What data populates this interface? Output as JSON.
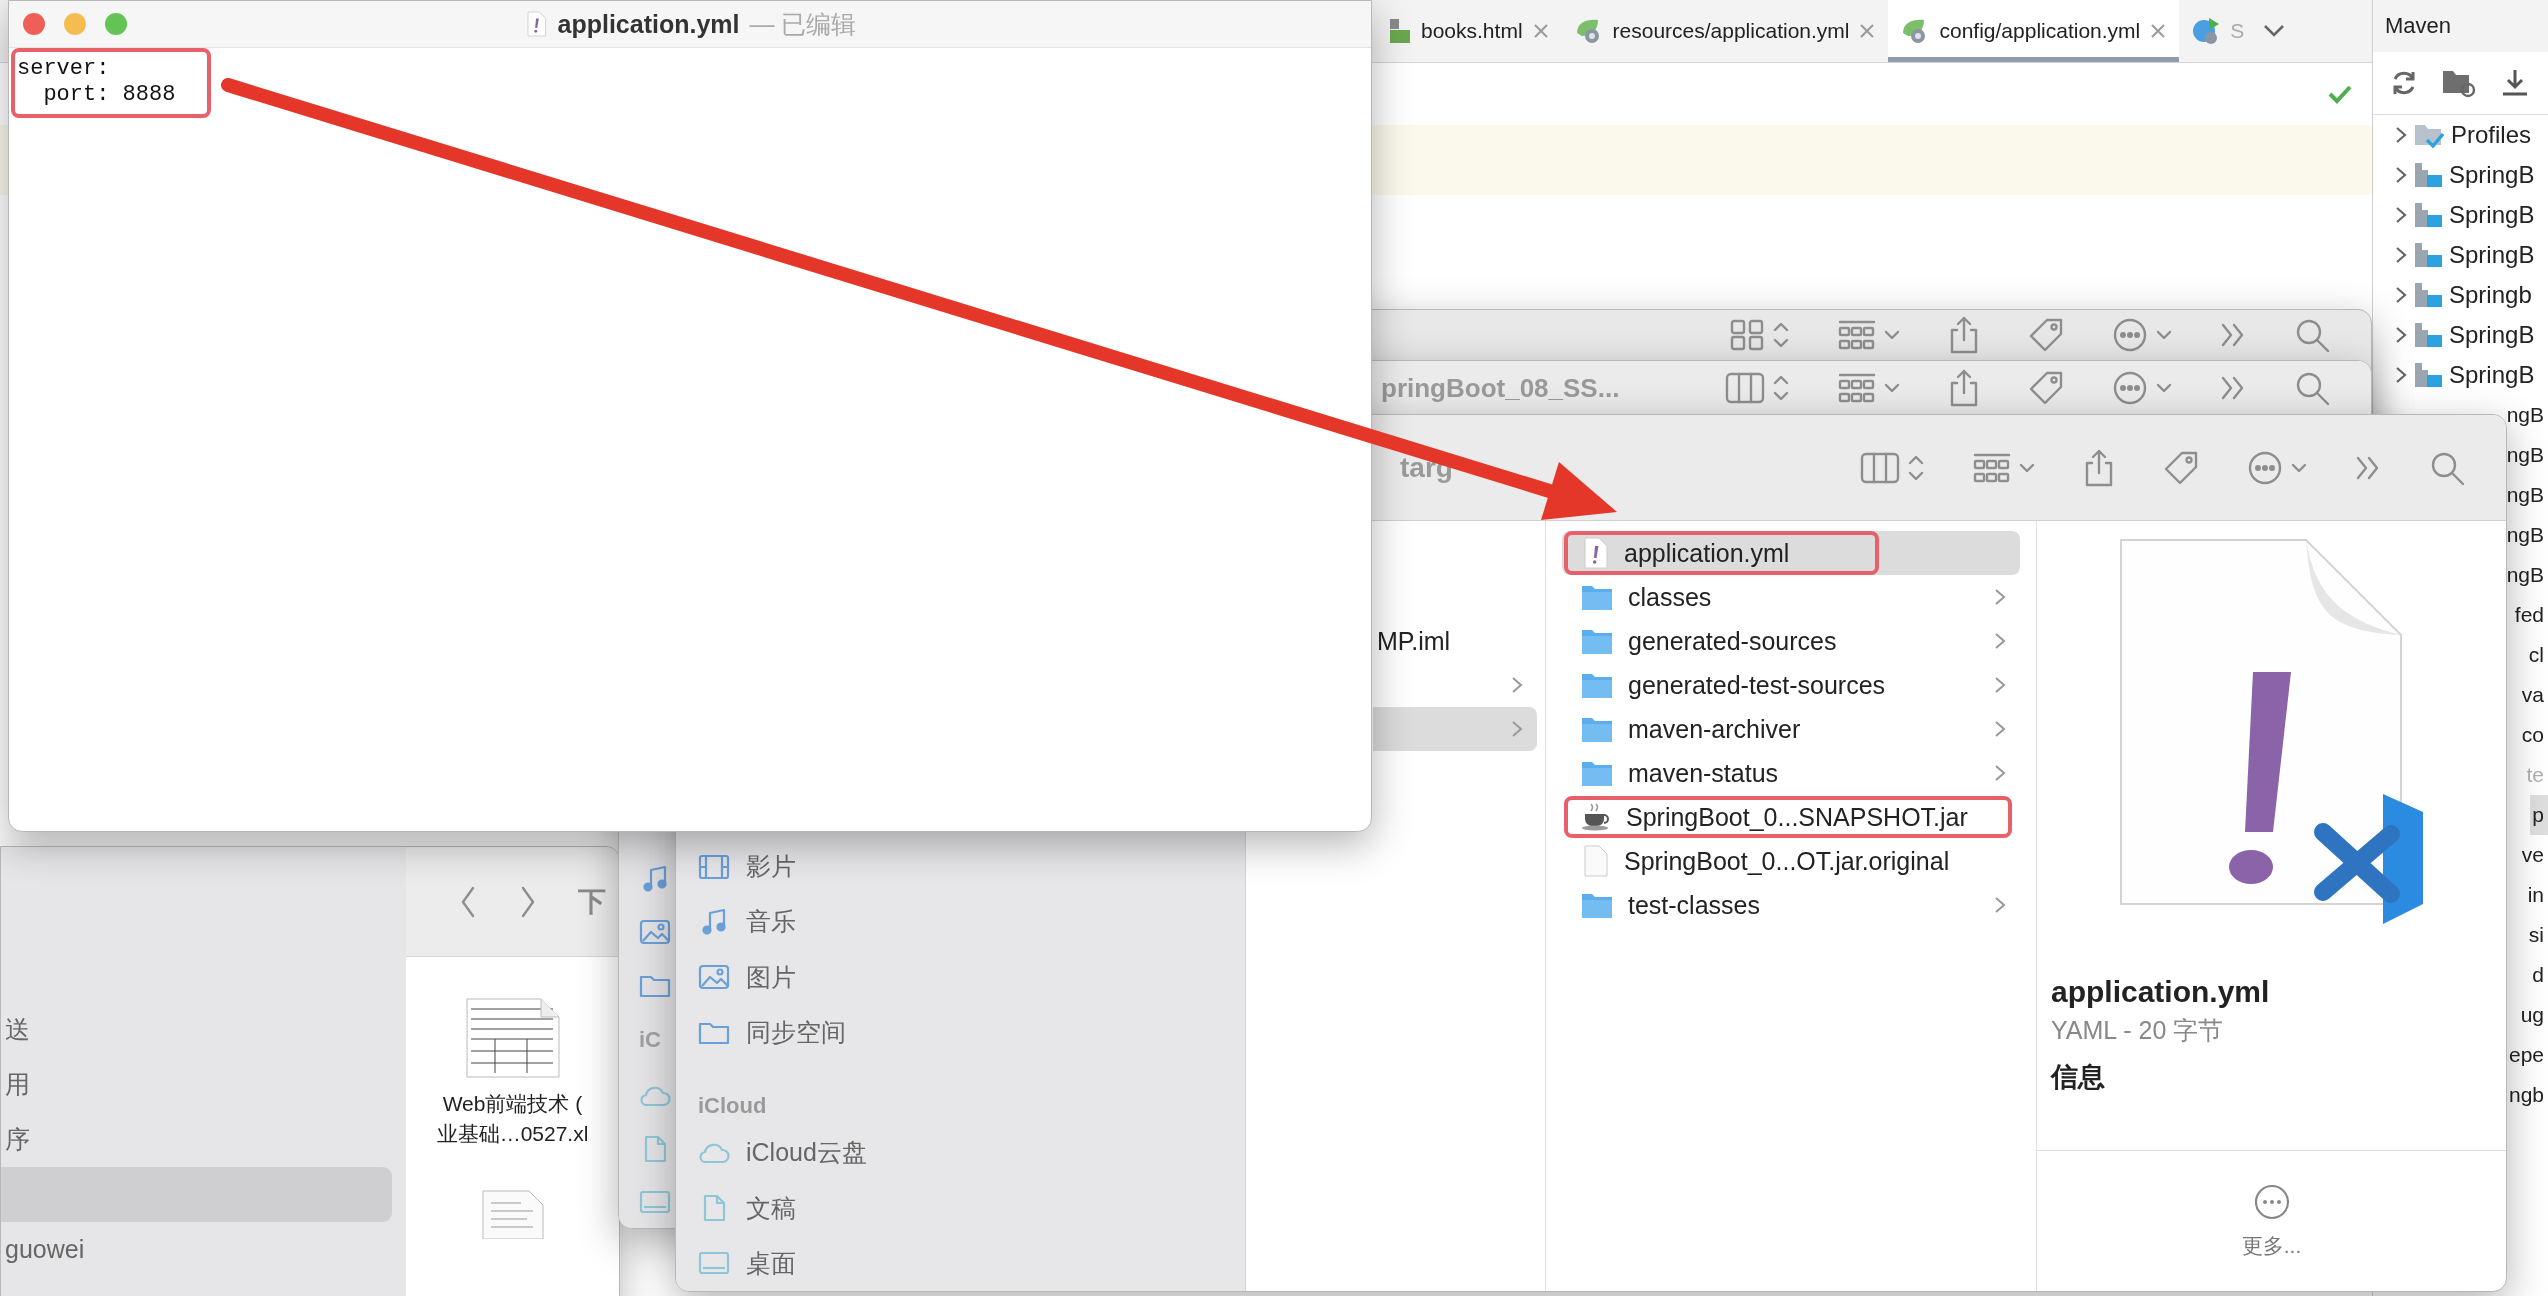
{
  "ide": {
    "tabs": [
      {
        "label": "books.html",
        "kind": "html",
        "selected": false
      },
      {
        "label": "resources/application.yml",
        "kind": "spring",
        "selected": false
      },
      {
        "label": "config/application.yml",
        "kind": "spring",
        "selected": true
      },
      {
        "label": "S",
        "kind": "run",
        "selected": false
      }
    ],
    "maven": {
      "title": "Maven",
      "items": [
        {
          "text": "Profiles",
          "kind": "profiles",
          "selected": false,
          "disabled": false
        },
        {
          "text": "SpringB",
          "kind": "module",
          "selected": false,
          "disabled": false
        },
        {
          "text": "SpringB",
          "kind": "module",
          "selected": false,
          "disabled": false
        },
        {
          "text": "SpringB",
          "kind": "module",
          "selected": false,
          "disabled": false
        },
        {
          "text": "Springb",
          "kind": "module",
          "selected": false,
          "disabled": false
        },
        {
          "text": "SpringB",
          "kind": "module",
          "selected": false,
          "disabled": false
        },
        {
          "text": "SpringB",
          "kind": "module",
          "selected": false,
          "disabled": false
        },
        {
          "text": "ngB",
          "kind": "tail",
          "selected": false,
          "disabled": false
        },
        {
          "text": "ngB",
          "kind": "tail",
          "selected": false,
          "disabled": false
        },
        {
          "text": "ngB",
          "kind": "tail",
          "selected": false,
          "disabled": false
        },
        {
          "text": "ngB",
          "kind": "tail",
          "selected": false,
          "disabled": false
        },
        {
          "text": "ngB",
          "kind": "tail",
          "selected": false,
          "disabled": false
        },
        {
          "text": "fed",
          "kind": "tail",
          "selected": false,
          "disabled": false
        },
        {
          "text": "cl",
          "kind": "tail",
          "selected": false,
          "disabled": false
        },
        {
          "text": "va",
          "kind": "tail",
          "selected": false,
          "disabled": false
        },
        {
          "text": "co",
          "kind": "tail",
          "selected": false,
          "disabled": false
        },
        {
          "text": "te",
          "kind": "tail",
          "selected": false,
          "disabled": true
        },
        {
          "text": "p",
          "kind": "tail",
          "selected": true,
          "disabled": false
        },
        {
          "text": "ve",
          "kind": "tail",
          "selected": false,
          "disabled": false
        },
        {
          "text": "in",
          "kind": "tail",
          "selected": false,
          "disabled": false
        },
        {
          "text": "si",
          "kind": "tail",
          "selected": false,
          "disabled": false
        },
        {
          "text": "d",
          "kind": "tail",
          "selected": false,
          "disabled": false
        },
        {
          "text": "ug",
          "kind": "tail",
          "selected": false,
          "disabled": false
        },
        {
          "text": "epe",
          "kind": "tail",
          "selected": false,
          "disabled": false
        },
        {
          "text": "ngb",
          "kind": "tail",
          "selected": false,
          "disabled": false
        }
      ]
    }
  },
  "editor": {
    "title": "application.yml",
    "status": "— 已编辑",
    "lines": [
      "server:",
      "  port: 8888"
    ],
    "annotated": true
  },
  "finder_middle": {
    "title": "pringBoot_08_SS...",
    "sidebar_section": "iC"
  },
  "finder_front": {
    "title": "targ",
    "sidebar": {
      "items": [
        {
          "label": "影片",
          "kind": "film"
        },
        {
          "label": "音乐",
          "kind": "music"
        },
        {
          "label": "图片",
          "kind": "photo"
        },
        {
          "label": "同步空间",
          "kind": "folder"
        }
      ],
      "section": "iCloud",
      "cloud_items": [
        {
          "label": "iCloud云盘",
          "kind": "cloud"
        },
        {
          "label": "文稿",
          "kind": "doc"
        },
        {
          "label": "桌面",
          "kind": "desktop"
        }
      ]
    },
    "column_1": [
      {
        "label": "MP.iml",
        "kind": "file",
        "selected": false
      },
      {
        "kind": "folder",
        "selected": false
      },
      {
        "kind": "folder",
        "selected": true
      }
    ],
    "files": [
      {
        "name": "application.yml",
        "kind": "yml",
        "selected": true,
        "annotated": true
      },
      {
        "name": "classes",
        "kind": "folder",
        "selected": false,
        "annotated": false
      },
      {
        "name": "generated-sources",
        "kind": "folder",
        "selected": false,
        "annotated": false
      },
      {
        "name": "generated-test-sources",
        "kind": "folder",
        "selected": false,
        "annotated": false
      },
      {
        "name": "maven-archiver",
        "kind": "folder",
        "selected": false,
        "annotated": false
      },
      {
        "name": "maven-status",
        "kind": "folder",
        "selected": false,
        "annotated": false
      },
      {
        "name": "SpringBoot_0...SNAPSHOT.jar",
        "kind": "jar",
        "selected": false,
        "annotated": true
      },
      {
        "name": "SpringBoot_0...OT.jar.original",
        "kind": "file",
        "selected": false,
        "annotated": false
      },
      {
        "name": "test-classes",
        "kind": "folder",
        "selected": false,
        "annotated": false
      }
    ],
    "preview": {
      "name": "application.yml",
      "meta": "YAML - 20 字节",
      "section": "信息",
      "more": "更多..."
    }
  },
  "finder_lower": {
    "title": "下",
    "sidebar": [
      {
        "label": "送",
        "selected": false
      },
      {
        "label": "用",
        "selected": false
      },
      {
        "label": "序",
        "selected": false
      },
      {
        "selected": true
      },
      {
        "label": "guowei",
        "selected": false
      }
    ],
    "file_name_lines": [
      "Web前端技术 (",
      "业基础…0527.xl"
    ]
  }
}
